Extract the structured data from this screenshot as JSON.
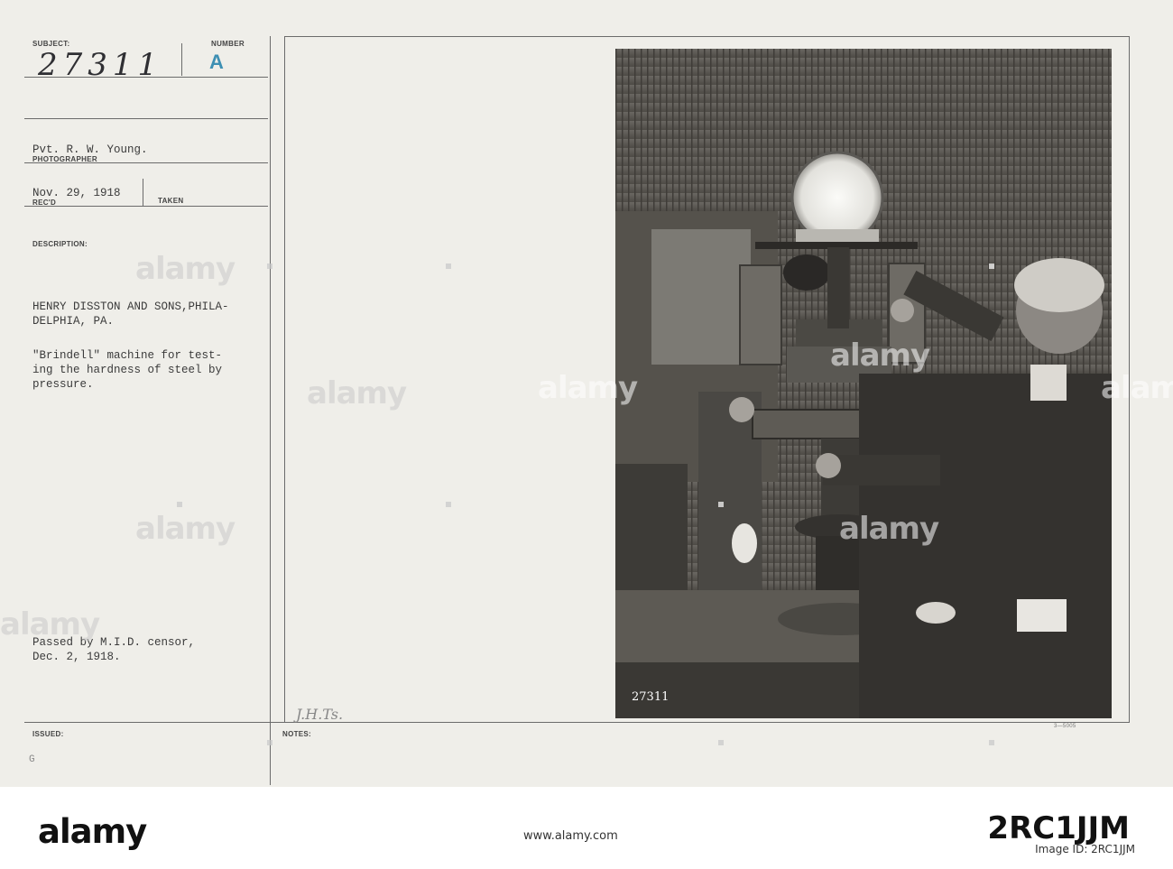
{
  "card": {
    "subject_label": "SUBJECT:",
    "subject_number": "27311",
    "number_label": "NUMBER",
    "number_letter": "A",
    "photographer_name": "Pvt. R. W. Young.",
    "photographer_label": "PHOTOGRAPHER",
    "received_date": "Nov. 29, 1918",
    "received_label": "REC'D",
    "taken_label": "TAKEN",
    "description_label": "DESCRIPTION:",
    "description_lines": [
      "HENRY DISSTON AND SONS,PHILA-",
      "DELPHIA, PA.",
      "",
      "\"Brindell\" machine for test-",
      "ing the hardness of steel by",
      "pressure."
    ],
    "censor_lines": [
      "Passed by M.I.D. censor,",
      "Dec. 2, 1918."
    ],
    "issued_label": "ISSUED:",
    "issued_mark": "G",
    "notes_label": "NOTES:",
    "notes_initials": "J.H.Ts.",
    "form_code": "3—5005",
    "photo_number": "27311"
  },
  "photo": {
    "description": "Two men operating a Brinell hardness testing machine with a large dial gauge in a factory workshop"
  },
  "watermark": {
    "text": "alamy"
  },
  "stock_footer": {
    "logo": "alamy",
    "url": "www.alamy.com",
    "image_id": "2RC1JJM",
    "id_label": "Image ID: 2RC1JJM"
  }
}
